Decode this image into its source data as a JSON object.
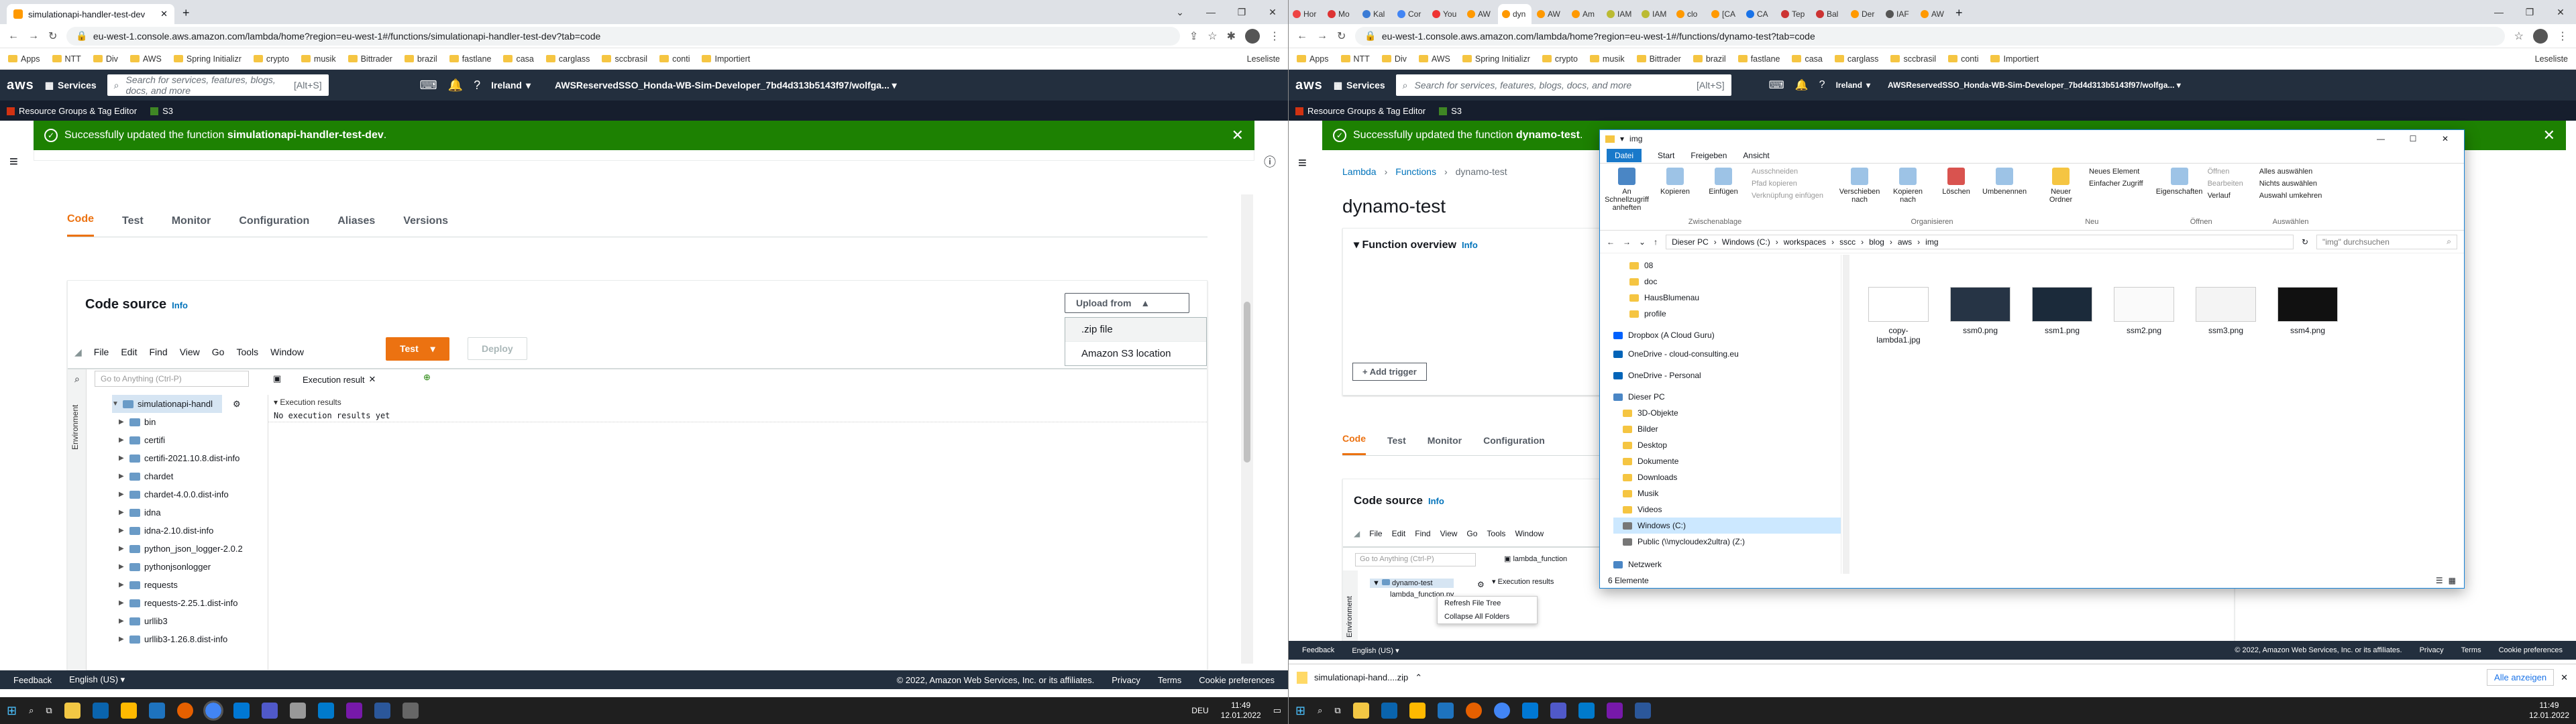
{
  "left": {
    "browser": {
      "tab_title": "simulationapi-handler-test-dev",
      "url": "eu-west-1.console.aws.amazon.com/lambda/home?region=eu-west-1#/functions/simulationapi-handler-test-dev?tab=code",
      "bookmarks": [
        "Apps",
        "NTT",
        "Div",
        "AWS",
        "Spring Initializr",
        "crypto",
        "musik",
        "Bittrader",
        "brazil",
        "fastlane",
        "casa",
        "carglass",
        "sccbrasil",
        "conti",
        "Importiert"
      ],
      "reading_list": "Leseliste"
    },
    "aws": {
      "services": "Services",
      "search_placeholder": "Search for services, features, blogs, docs, and more",
      "search_shortcut": "[Alt+S]",
      "region": "Ireland",
      "account": "AWSReservedSSO_Honda-WB-Sim-Developer_7bd4d313b5143f97/wolfga...",
      "fav_resource_groups": "Resource Groups & Tag Editor",
      "fav_s3": "S3"
    },
    "flash": {
      "prefix": "Successfully updated the function ",
      "function": "simulationapi-handler-test-dev",
      "suffix": "."
    },
    "tabs": [
      "Code",
      "Test",
      "Monitor",
      "Configuration",
      "Aliases",
      "Versions"
    ],
    "code_source": {
      "title": "Code source",
      "info": "Info",
      "upload_from": "Upload from",
      "upload_options": [
        ".zip file",
        "Amazon S3 location"
      ],
      "menu": [
        "File",
        "Edit",
        "Find",
        "View",
        "Go",
        "Tools",
        "Window"
      ],
      "test_button": "Test",
      "deploy_button": "Deploy",
      "goto_placeholder": "Go to Anything (Ctrl-P)",
      "environment_label": "Environment",
      "exec_tab": "Execution result",
      "exec_title": "Execution results",
      "exec_text": "No execution results yet",
      "tree_root": "simulationapi-handl",
      "tree": [
        "bin",
        "certifi",
        "certifi-2021.10.8.dist-info",
        "chardet",
        "chardet-4.0.0.dist-info",
        "idna",
        "idna-2.10.dist-info",
        "python_json_logger-2.0.2",
        "pythonjsonlogger",
        "requests",
        "requests-2.25.1.dist-info",
        "urllib3",
        "urllib3-1.26.8.dist-info"
      ]
    },
    "footer": {
      "feedback": "Feedback",
      "language": "English (US)",
      "copyright": "© 2022, Amazon Web Services, Inc. or its affiliates.",
      "privacy": "Privacy",
      "terms": "Terms",
      "cookies": "Cookie preferences"
    },
    "taskbar": {
      "time": "11:49",
      "date": "12.01.2022",
      "lang": "DEU"
    }
  },
  "right": {
    "browser": {
      "tab_labels": [
        "Hor",
        "Mo",
        "Kal",
        "Cor",
        "You",
        "AW",
        "dyn",
        "AW",
        "Am",
        "IAM",
        "IAM",
        "clo",
        "[CA",
        "CA",
        "Tep",
        "Bal",
        "Der",
        "IAF",
        "AW"
      ],
      "url": "eu-west-1.console.aws.amazon.com/lambda/home?region=eu-west-1#/functions/dynamo-test?tab=code",
      "bookmarks": [
        "Apps",
        "NTT",
        "Div",
        "AWS",
        "Spring Initializr",
        "crypto",
        "musik",
        "Bittrader",
        "brazil",
        "fastlane",
        "casa",
        "carglass",
        "sccbrasil",
        "conti",
        "Importiert"
      ],
      "reading_list": "Leseliste"
    },
    "aws": {
      "services": "Services",
      "search_placeholder": "Search for services, features, blogs, docs, and more",
      "search_shortcut": "[Alt+S]",
      "region": "Ireland",
      "account": "AWSReservedSSO_Honda-WB-Sim-Developer_7bd4d313b5143f97/wolfga...",
      "fav_resource_groups": "Resource Groups & Tag Editor",
      "fav_s3": "S3"
    },
    "flash": {
      "prefix": "Successfully updated the function ",
      "function": "dynamo-test",
      "suffix": "."
    },
    "breadcrumb": [
      "Lambda",
      "Functions",
      "dynamo-test"
    ],
    "function_name": "dynamo-test",
    "overview": "Function overview",
    "info": "Info",
    "add_trigger": "+ Add trigger",
    "tabs": [
      "Code",
      "Test",
      "Monitor",
      "Configuration"
    ],
    "code_source": {
      "title": "Code source",
      "info": "Info",
      "menu": [
        "File",
        "Edit",
        "Find",
        "View",
        "Go",
        "Tools",
        "Window"
      ],
      "goto_placeholder": "Go to Anything (Ctrl-P)",
      "environment_label": "Environment",
      "exec_tab": "lambda_function",
      "exec_title": "Execution results",
      "tree_root": "dynamo-test",
      "tree_file": "lambda_function.py",
      "context_menu": [
        "Refresh File Tree",
        "Collapse All Folders"
      ]
    },
    "explorer": {
      "title": "img",
      "ribbon_tabs": [
        "Datei",
        "Start",
        "Freigeben",
        "Ansicht"
      ],
      "ribbon": {
        "pin": "An Schnellzugriff anheften",
        "copy": "Kopieren",
        "paste": "Einfügen",
        "cut": "Ausschneiden",
        "copy_path": "Pfad kopieren",
        "paste_shortcut": "Verknüpfung einfügen",
        "clipboard_group": "Zwischenablage",
        "move": "Verschieben nach",
        "copy_to": "Kopieren nach",
        "delete": "Löschen",
        "rename": "Umbenennen",
        "organize_group": "Organisieren",
        "new_folder": "Neuer Ordner",
        "new_element": "Neues Element",
        "easy_access": "Einfacher Zugriff",
        "new_group": "Neu",
        "properties": "Eigenschaften",
        "open": "Öffnen",
        "edit": "Bearbeiten",
        "history": "Verlauf",
        "open_group": "Öffnen",
        "select_all": "Alles auswählen",
        "select_none": "Nichts auswählen",
        "invert": "Auswahl umkehren",
        "select_group": "Auswählen"
      },
      "path": [
        "Dieser PC",
        "Windows (C:)",
        "workspaces",
        "sscc",
        "blog",
        "aws",
        "img"
      ],
      "search_placeholder": "\"img\" durchsuchen",
      "nav": [
        "08",
        "doc",
        "HausBlumenau",
        "profile",
        "Dropbox (A Cloud Guru)",
        "OneDrive - cloud-consulting.eu",
        "OneDrive - Personal",
        "Dieser PC",
        "3D-Objekte",
        "Bilder",
        "Desktop",
        "Dokumente",
        "Downloads",
        "Musik",
        "Videos",
        "Windows (C:)",
        "Public (\\\\mycloudex2ultra) (Z:)",
        "Netzwerk"
      ],
      "files": [
        "copy-lambda1.jpg",
        "ssm0.png",
        "ssm1.png",
        "ssm2.png",
        "ssm3.png",
        "ssm4.png"
      ],
      "status": "6 Elemente"
    },
    "download": {
      "file": "simulationapi-hand....zip",
      "show_all": "Alle anzeigen"
    },
    "footer": {
      "feedback": "Feedback",
      "language": "English (US)",
      "copyright": "© 2022, Amazon Web Services, Inc. or its affiliates.",
      "privacy": "Privacy",
      "terms": "Terms",
      "cookies": "Cookie preferences"
    },
    "taskbar": {
      "time": "11:49",
      "date": "12.01.2022"
    }
  }
}
